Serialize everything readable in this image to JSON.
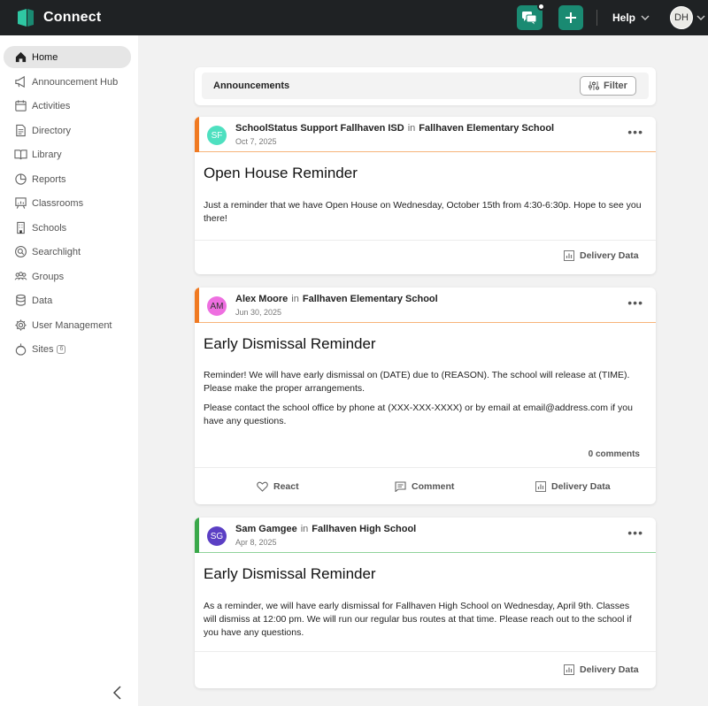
{
  "app": {
    "title": "Connect"
  },
  "topbar": {
    "help_label": "Help",
    "avatar_initials": "DH"
  },
  "sidebar": {
    "items": [
      {
        "label": "Home"
      },
      {
        "label": "Announcement Hub"
      },
      {
        "label": "Activities"
      },
      {
        "label": "Directory"
      },
      {
        "label": "Library"
      },
      {
        "label": "Reports"
      },
      {
        "label": "Classrooms"
      },
      {
        "label": "Schools"
      },
      {
        "label": "Searchlight"
      },
      {
        "label": "Groups"
      },
      {
        "label": "Data"
      },
      {
        "label": "User Management"
      },
      {
        "label": "Sites",
        "badge": "6"
      }
    ]
  },
  "announcements": {
    "title": "Announcements",
    "filter_label": "Filter",
    "posts": [
      {
        "author": "SchoolStatus Support Fallhaven ISD",
        "initials": "SF",
        "in_label": "in",
        "school": "Fallhaven Elementary School",
        "date": "Oct 7, 2025",
        "title": "Open House Reminder",
        "body": [
          "Just a reminder that we have Open House on Wednesday, October 15th from 4:30-6:30p. Hope to see you there!"
        ],
        "delivery_label": "Delivery Data",
        "accent": "#f07a22",
        "avatar_bg": "#4ee0c0"
      },
      {
        "author": "Alex Moore",
        "initials": "AM",
        "in_label": "in",
        "school": "Fallhaven Elementary School",
        "date": "Jun 30, 2025",
        "title": "Early Dismissal Reminder",
        "body": [
          "Reminder! We will have early dismissal on (DATE) due to (REASON). The school will release at (TIME). Please make the proper arrangements.",
          "Please contact the school office by phone at (XXX-XXX-XXXX) or by email at email@address.com if you have any questions."
        ],
        "comments_label": "0 comments",
        "react_label": "React",
        "comment_label": "Comment",
        "delivery_label": "Delivery Data",
        "accent": "#f07a22",
        "avatar_bg": "#ee6fe0"
      },
      {
        "author": "Sam Gamgee",
        "initials": "SG",
        "in_label": "in",
        "school": "Fallhaven High School",
        "date": "Apr 8, 2025",
        "title": "Early Dismissal Reminder",
        "body": [
          "As a reminder, we will have early dismissal for Fallhaven High School on Wednesday, April 9th. Classes will dismiss at 12:00 pm. We will run our regular bus routes at that time. Please reach out to the school if you have any questions."
        ],
        "delivery_label": "Delivery Data",
        "accent": "#3aa84a",
        "avatar_bg": "#5b3fc4"
      }
    ]
  },
  "colors": {
    "brand": "#1a8a72",
    "topbar": "#1f2224"
  }
}
